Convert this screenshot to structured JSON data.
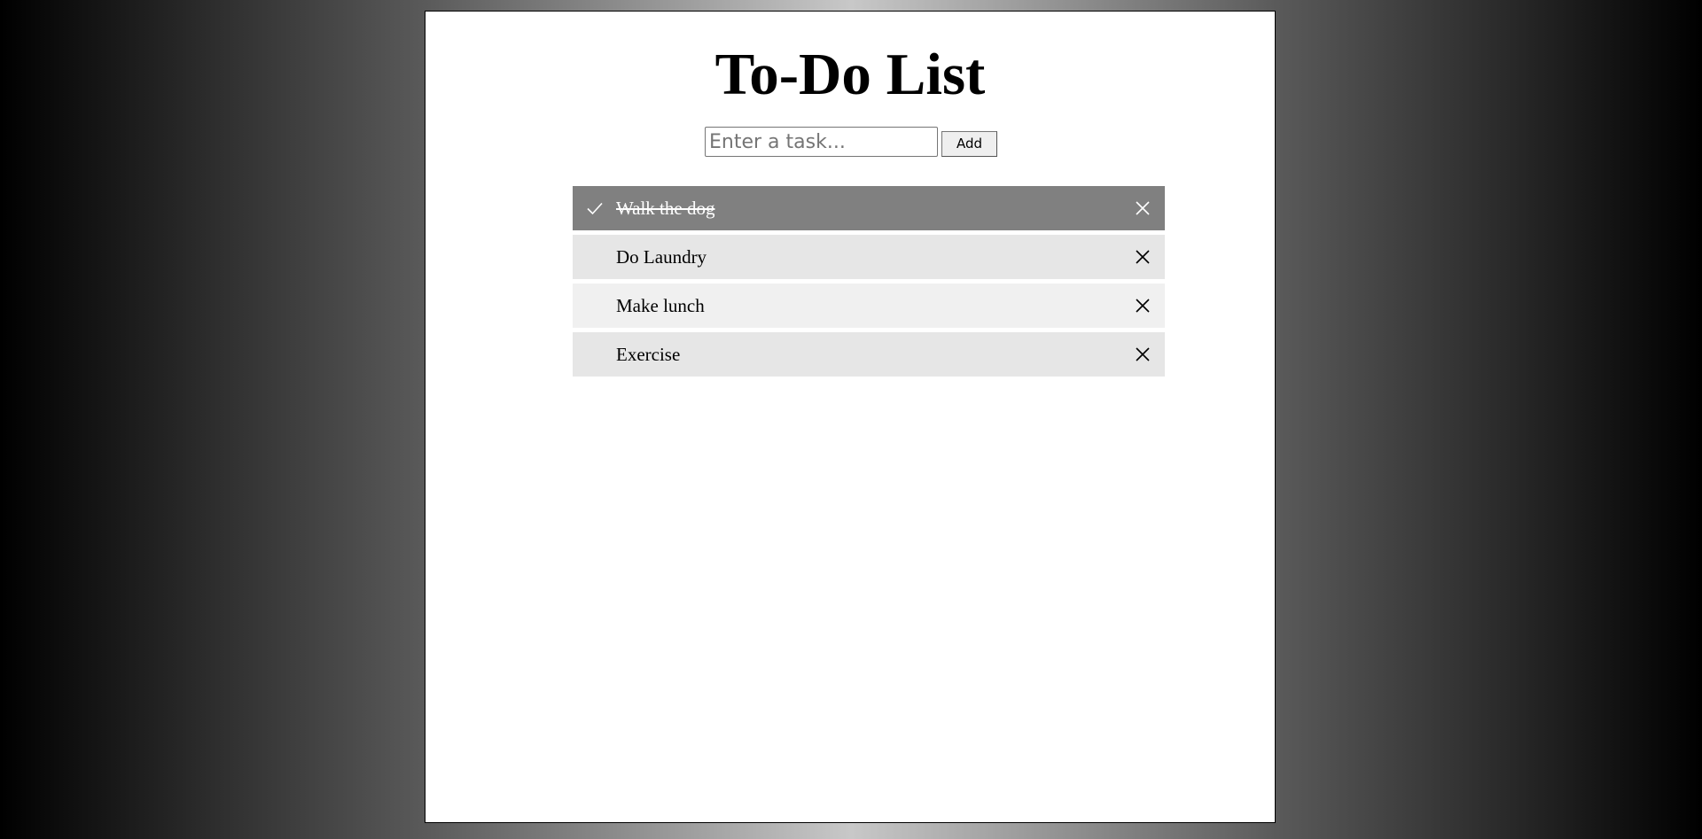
{
  "app": {
    "title": "To-Do List"
  },
  "form": {
    "input_value": "",
    "input_placeholder": "Enter a task...",
    "add_label": "Add"
  },
  "tasks": [
    {
      "label": "Walk the dog",
      "checked": true
    },
    {
      "label": "Do Laundry",
      "checked": false
    },
    {
      "label": "Make lunch",
      "checked": false
    },
    {
      "label": "Exercise",
      "checked": false
    }
  ],
  "icons": {
    "check": "check-icon",
    "close": "close-icon"
  },
  "colors": {
    "checked_bg": "#808080",
    "row_odd_bg": "#e6e6e6",
    "row_even_bg": "#f0f0f0",
    "panel_bg": "#ffffff"
  }
}
